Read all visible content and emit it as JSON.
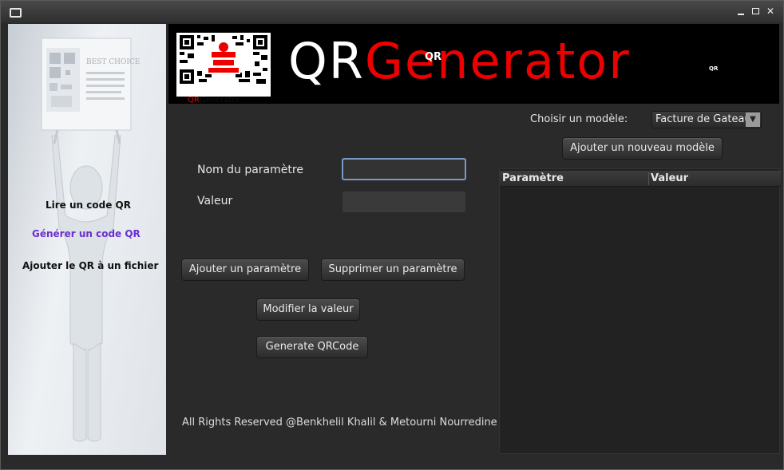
{
  "sidebar": {
    "poster_text": "BEST CHOICE",
    "items": [
      {
        "label": "Lire un code QR"
      },
      {
        "label": "Générer un code QR"
      },
      {
        "label": "Ajouter le QR à un fichier"
      }
    ]
  },
  "banner": {
    "caption_red": "QR",
    "caption_rest": "Generator",
    "title_white": "QR",
    "title_red": "Generator",
    "small_qr": "QR",
    "dot_qr": "QR"
  },
  "form": {
    "name_label": "Nom du paramètre",
    "name_value": "",
    "value_label": "Valeur",
    "value_value": "",
    "add_param_button": "Ajouter un paramètre",
    "delete_param_button": "Supprimer un paramètre",
    "modify_button": "Modifier la valeur",
    "generate_button": "Generate QRCode"
  },
  "model": {
    "label": "Choisir un modèle:",
    "selected": "Facture de Gateau",
    "new_model_button": "Ajouter un nouveau modèle"
  },
  "table": {
    "columns": [
      "Paramètre",
      "Valeur"
    ],
    "rows": []
  },
  "footer": "All Rights Reserved @Benkhelil Khalil & Metourni Nourredine",
  "colors": {
    "accent_red": "#ee0000",
    "link_purple": "#6a2fd0",
    "background": "#2a2a2a"
  }
}
